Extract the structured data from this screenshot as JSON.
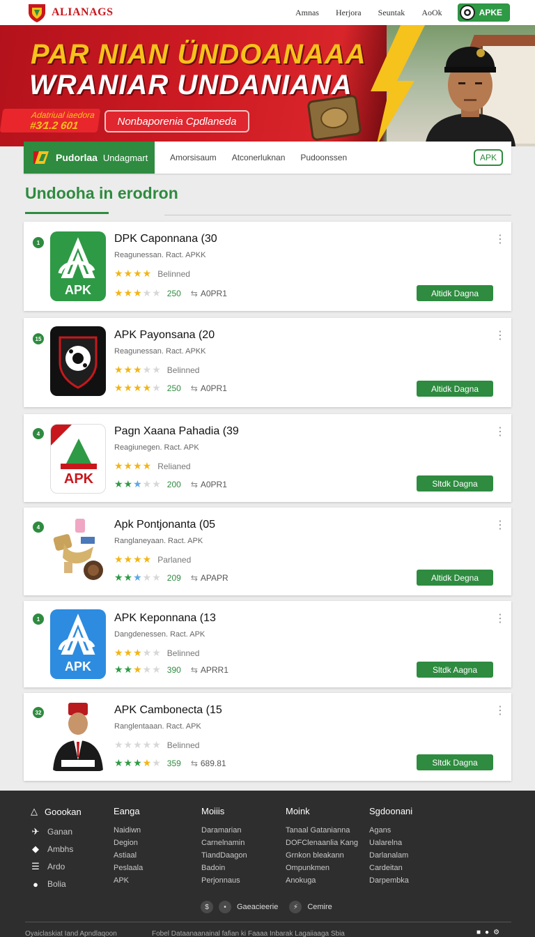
{
  "brand": {
    "name": "ALIANAGS"
  },
  "topnav": {
    "links": [
      "Amnas",
      "Herjora",
      "Seuntak",
      "AoOk"
    ],
    "apk_button": "APKE"
  },
  "hero": {
    "title_line1": "PAR NIAN ÜNDOANAAA",
    "title_line2": "WRANIAR UNDANIANA",
    "tag_small": "Adatriual iaedora",
    "tag_number": "#3⁄1.2 601",
    "tag_button": "Nonbaporenia Cpdlaneda"
  },
  "tabs": {
    "active": "Pudorlaa",
    "active_suffix": "Undagmart",
    "items": [
      "Amorsisaum",
      "Atconerluknan",
      "Pudoonssen"
    ],
    "apk_label": "APK"
  },
  "section": {
    "title": "Undooha in erodron"
  },
  "apps": [
    {
      "rank": "1",
      "name": "DPK Caponnana (30",
      "sub": "Reagunessan. Ract. APKK",
      "rating_label": "Belinned",
      "count": "250",
      "code": "A0PR1",
      "button": "Altidk Dagna",
      "icon": "apk-green-icon",
      "icon_label": "APK"
    },
    {
      "rank": "15",
      "name": "APK Payonsana (20",
      "sub": "Reagunessan. Ract. APKK",
      "rating_label": "Belinned",
      "count": "250",
      "code": "A0PR1",
      "button": "Altidk Dagna",
      "icon": "shield-black-icon",
      "icon_label": ""
    },
    {
      "rank": "4",
      "name": "Pagn Xaana Pahadia (39",
      "sub": "Reagiunegen. Ract. APK",
      "rating_label": "Relianed",
      "count": "200",
      "code": "A0PR1",
      "button": "Sltdk Dagna",
      "icon": "apk-flag-icon",
      "icon_label": "APK"
    },
    {
      "rank": "4",
      "name": "Apk Pontjonanta (05",
      "sub": "Ranglaneyaan. Ract. APK",
      "rating_label": "Parlaned",
      "count": "209",
      "code": "APAPR",
      "button": "Altidk Degna",
      "icon": "treasure-icon",
      "icon_label": ""
    },
    {
      "rank": "1",
      "name": "APK Keponnana (13",
      "sub": "Dangdenessen. Ract. APK",
      "rating_label": "Belinned",
      "count": "390",
      "code": "APRR1",
      "button": "Sltdk Aagna",
      "icon": "apk-blue-icon",
      "icon_label": "APK"
    },
    {
      "rank": "32",
      "name": "APK Cambonecta (15",
      "sub": "Ranglentaaan. Ract. APK",
      "rating_label": "Belinned",
      "count": "359",
      "code": "689.81",
      "button": "Sltdk Dagna",
      "icon": "person-avatar-icon",
      "icon_label": ""
    }
  ],
  "footer": {
    "col1": {
      "title": "Goookan",
      "links": [
        "Ganan",
        "Ambhs",
        "Ardo",
        "Bolia"
      ]
    },
    "col2": {
      "title": "Eanga",
      "links": [
        "Naidiwn",
        "Degion",
        "Astiaal",
        "Peslaala",
        "APK"
      ]
    },
    "col3": {
      "title": "Moiiis",
      "links": [
        "Daramarian",
        "Carnelnamin",
        "TiandDaagon",
        "Badoin",
        "Perjonnaus"
      ]
    },
    "col4": {
      "title": "Moink",
      "links": [
        "Tanaal Gatanianna",
        "DOFClenaanlia Kang",
        "Grnkon bleakann",
        "Ompunkmen",
        "Anokuga"
      ]
    },
    "col5": {
      "title": "Sgdoonani",
      "links": [
        "Agans",
        "Ualarelna",
        "Darlanalam",
        "Cardeitan",
        "Darpembka"
      ]
    },
    "social_1": "Gaeacieerie",
    "social_2": "Cemire",
    "bottom_left": "Oyaiclaskiat Iand Apndlaqoon",
    "bottom_center": "Fobel Dataanaanainal fafian ki Faaaa Inbarak Lagaiiaaga Sbia"
  },
  "colors": {
    "brand_red": "#c8171c",
    "brand_green": "#2e8b3f",
    "gold": "#f6c21c",
    "footer_bg": "#2e2e2e"
  }
}
